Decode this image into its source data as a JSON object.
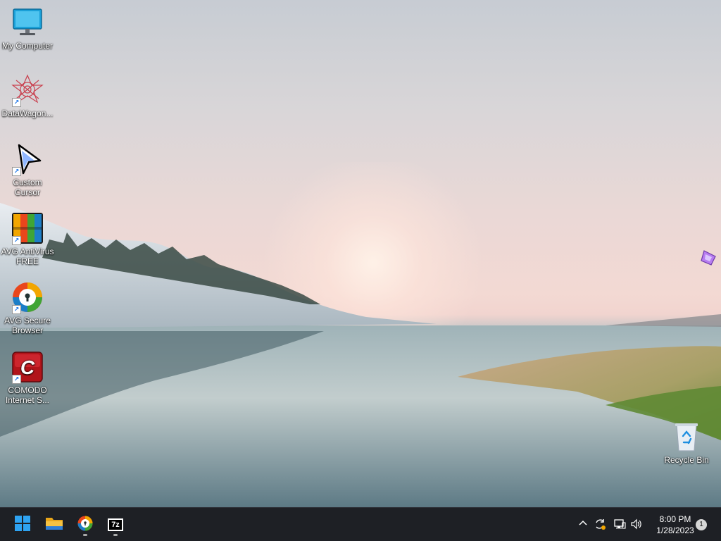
{
  "desktop": {
    "icons": [
      {
        "name": "my-computer",
        "label": "My Computer",
        "icon": "monitor-icon"
      },
      {
        "name": "datawagon",
        "label": "DataWagon...",
        "icon": "datawagon-icon",
        "shortcut": true
      },
      {
        "name": "custom-cursor",
        "label": "Custom\nCursor",
        "icon": "cursor-icon",
        "shortcut": true
      },
      {
        "name": "avg-antivirus",
        "label": "AVG AntiVirus\nFREE",
        "icon": "avg-icon",
        "shortcut": true
      },
      {
        "name": "avg-secure-browser",
        "label": "AVG Secure\nBrowser",
        "icon": "avg-browser-icon",
        "shortcut": true
      },
      {
        "name": "comodo-internet-security",
        "label": "COMODO\nInternet S...",
        "icon": "comodo-icon",
        "shortcut": true
      }
    ],
    "recycle_bin": {
      "label": "Recycle Bin",
      "icon": "recycle-bin-icon"
    }
  },
  "taskbar": {
    "apps": [
      {
        "name": "start",
        "icon": "windows-start-icon"
      },
      {
        "name": "file-explorer",
        "icon": "folder-icon"
      },
      {
        "name": "avg-secure-browser",
        "icon": "avg-browser-icon",
        "running": true
      },
      {
        "name": "7zip",
        "icon": "7zip-icon",
        "label": "7z",
        "running": true
      }
    ],
    "tray": {
      "chevron_icon": "chevron-up-icon",
      "sync_icon": "sync-icon",
      "network_icon": "network-icon",
      "volume_icon": "volume-icon"
    },
    "clock": {
      "time": "8:00 PM",
      "date": "1/28/2023"
    },
    "notifications": {
      "count": "1"
    }
  },
  "colors": {
    "taskbar_bg": "#1e2025",
    "start_blue": "#2ea3f2",
    "folder_yellow": "#f5c242",
    "comodo_red": "#c8161d"
  }
}
